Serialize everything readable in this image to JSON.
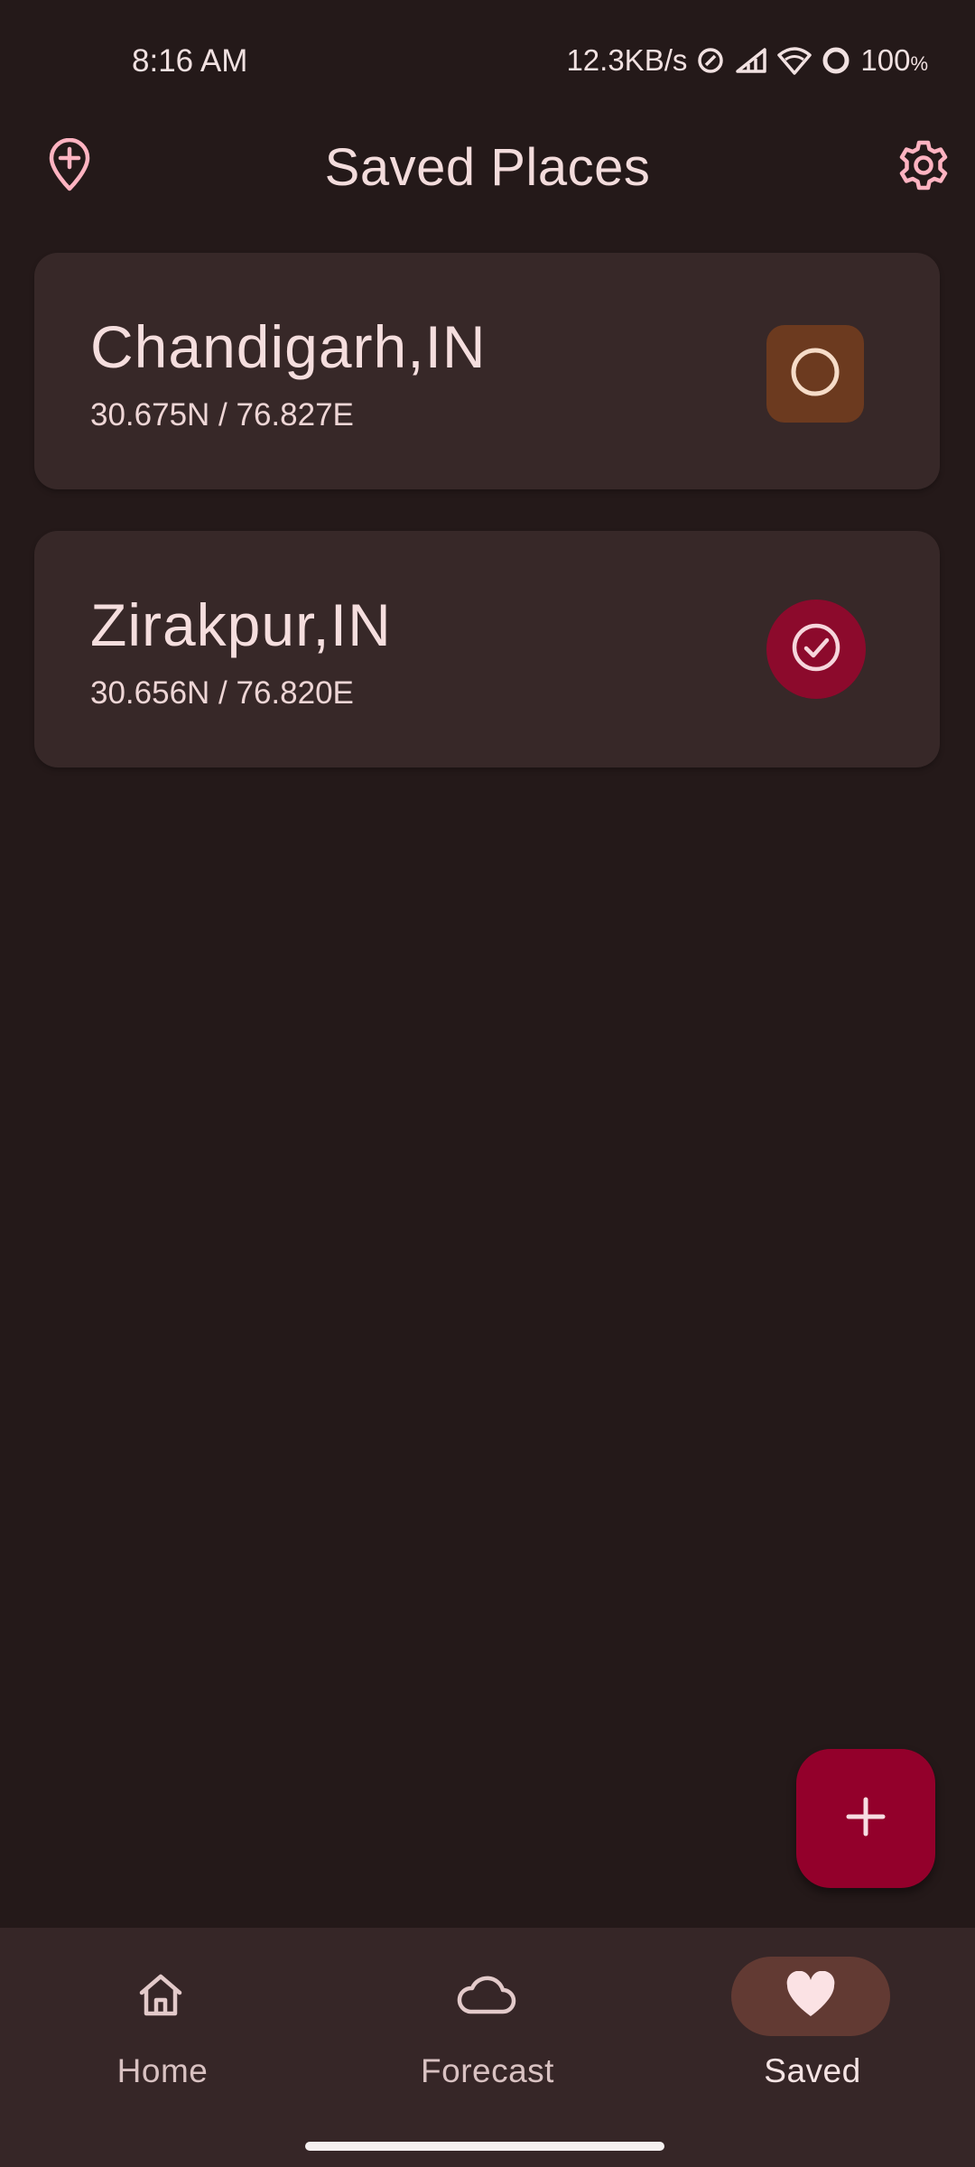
{
  "status_bar": {
    "time": "8:16 AM",
    "network_speed": "12.3KB/s",
    "battery": "100",
    "battery_unit": "%"
  },
  "app_bar": {
    "title": "Saved Places",
    "left_icon": "add-location-icon",
    "right_icon": "gear-icon"
  },
  "places": [
    {
      "name": "Chandigarh,IN",
      "coords": "30.675N / 76.827E",
      "selected": false,
      "action_icon": "circle-outline-icon"
    },
    {
      "name": "Zirakpur,IN",
      "coords": "30.656N / 76.820E",
      "selected": true,
      "action_icon": "check-circle-icon"
    }
  ],
  "fab": {
    "icon": "plus-icon"
  },
  "bottom_nav": {
    "items": [
      {
        "label": "Home",
        "icon": "home-icon",
        "active": false
      },
      {
        "label": "Forecast",
        "icon": "cloud-icon",
        "active": false
      },
      {
        "label": "Saved",
        "icon": "heart-icon",
        "active": true
      }
    ]
  },
  "colors": {
    "background": "#241919",
    "card": "#372828",
    "accent": "#93002b",
    "unselected_action": "#6c3a1f",
    "nav_active_pill": "#623a33",
    "icon_pink": "#ffb3c1"
  }
}
